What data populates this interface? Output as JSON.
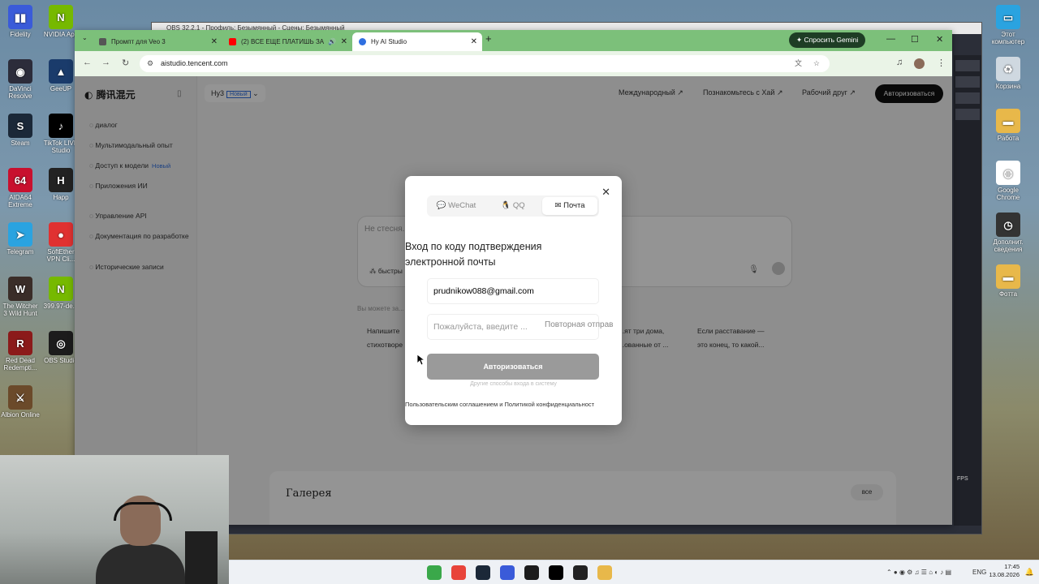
{
  "desktop": {
    "left_icons": [
      {
        "label": "Fidelity",
        "color": "#3a5bd9",
        "glyph": "▮▮"
      },
      {
        "label": "NVIDIA App",
        "color": "#76b900",
        "glyph": "N"
      },
      {
        "label": "DaVinci Resolve",
        "color": "#2c2c3a",
        "glyph": "◉"
      },
      {
        "label": "GeeUP",
        "color": "#1a3b6b",
        "glyph": "▲"
      },
      {
        "label": "Steam",
        "color": "#1b2838",
        "glyph": "S"
      },
      {
        "label": "TikTok LIVE Studio",
        "color": "#000000",
        "glyph": "♪"
      },
      {
        "label": "AIDA64 Extreme",
        "color": "#c8102e",
        "glyph": "64"
      },
      {
        "label": "Happ",
        "color": "#222222",
        "glyph": "H"
      },
      {
        "label": "Telegram",
        "color": "#2aa3e0",
        "glyph": "➤"
      },
      {
        "label": "SoftEther VPN Cli...",
        "color": "#e03131",
        "glyph": "●"
      },
      {
        "label": "The Witcher 3 Wild Hunt",
        "color": "#3a2d28",
        "glyph": "W"
      },
      {
        "label": "399.97-de...",
        "color": "#76b900",
        "glyph": "N"
      },
      {
        "label": "Red Dead Redempti...",
        "color": "#8b1a1a",
        "glyph": "R"
      },
      {
        "label": "OBS Studio",
        "color": "#1c1c1c",
        "glyph": "◎"
      },
      {
        "label": "Albion Online",
        "color": "#6b4a2a",
        "glyph": "⚔"
      }
    ],
    "right_icons": [
      {
        "label": "Этот компьютер",
        "color": "#2aa3e0",
        "glyph": "▭"
      },
      {
        "label": "Корзина",
        "color": "#cfd8e0",
        "glyph": "♻"
      },
      {
        "label": "Работа",
        "color": "#e8b84a",
        "glyph": "▬"
      },
      {
        "label": "Google Chrome",
        "color": "#ffffff",
        "glyph": "◍"
      },
      {
        "label": "Дополнит. сведения",
        "color": "#333333",
        "glyph": "◷"
      },
      {
        "label": "Фотта",
        "color": "#e8b84a",
        "glyph": "▬"
      }
    ]
  },
  "obs_window": {
    "title": "OBS 32.2.1 - Профиль: Безымянный - Сцены: Безымянный",
    "fps": "FPS"
  },
  "browser": {
    "tabs": [
      {
        "label": "Промпт для Veo 3",
        "favicon_color": "#555555",
        "active": false
      },
      {
        "label": "(2) ВСЕ ЕЩЕ ПЛАТИШЬ ЗА",
        "favicon_color": "#ff0000",
        "active": false
      },
      {
        "label": "Hy AI Studio",
        "favicon_color": "#2f6fe0",
        "active": true
      }
    ],
    "gemini_button": "Спросить Gemini",
    "url": "aistudio.tencent.com"
  },
  "site": {
    "brand": "腾讯混元",
    "model": {
      "name": "Hy3",
      "badge": "Новый"
    },
    "sidebar": [
      {
        "label": "диалог",
        "badge": ""
      },
      {
        "label": "Мультимодальный опыт",
        "badge": ""
      },
      {
        "label": "Доступ к модели",
        "badge": "Новый"
      },
      {
        "label": "Приложения ИИ",
        "badge": ""
      },
      {
        "label": "Управление API",
        "badge": ""
      },
      {
        "label": "Документация по разработке",
        "badge": ""
      },
      {
        "label": "Исторические записи",
        "badge": ""
      }
    ],
    "topnav": [
      "Международный ↗",
      "Познакомьтесь с Хай ↗",
      "Рабочий друг ↗"
    ],
    "login_button": "Авторизоваться",
    "prompt_placeholder": "Не стесня...",
    "fast_label": "быстры",
    "hint": "Вы можете за...",
    "cards": [
      {
        "line1": "Напишите",
        "line2": "стихотворе"
      },
      {
        "line1": "...ят три дома,",
        "line2": "...ованные от ..."
      },
      {
        "line1": "Если расставание —",
        "line2": "это конец, то какой..."
      }
    ],
    "gallery": {
      "title": "Галерея",
      "all_label": "все"
    }
  },
  "modal": {
    "tabs": [
      "WeChat",
      "QQ",
      "Почта"
    ],
    "active_tab": "Почта",
    "title": "Вход по коду подтверждения электронной почты",
    "email_value": "prudnikow088@gmail.com",
    "code_placeholder": "Пожалуйста, введите ...",
    "resend_label": "Повторная отправ",
    "submit_label": "Авторизоваться",
    "other_methods": "Другие способы входа в систему",
    "agreement_part1": "Пользовательским соглашением",
    "agreement_and": "и",
    "agreement_part2": "Политикой конфиденциальност"
  },
  "taskbar": {
    "apps": [
      {
        "name": "refresh-app",
        "color": "#3aa84a"
      },
      {
        "name": "chrome-app",
        "color": "#e8443a"
      },
      {
        "name": "steam-app",
        "color": "#1b2838"
      },
      {
        "name": "fidelity-app",
        "color": "#3a5bd9"
      },
      {
        "name": "obs-app",
        "color": "#1c1c1c"
      },
      {
        "name": "tiktok-app",
        "color": "#000000"
      },
      {
        "name": "happ-app",
        "color": "#222222"
      },
      {
        "name": "explorer-app",
        "color": "#e8b84a"
      }
    ],
    "lang": "ENG",
    "time": "17:45",
    "date": "13.08.2026"
  }
}
